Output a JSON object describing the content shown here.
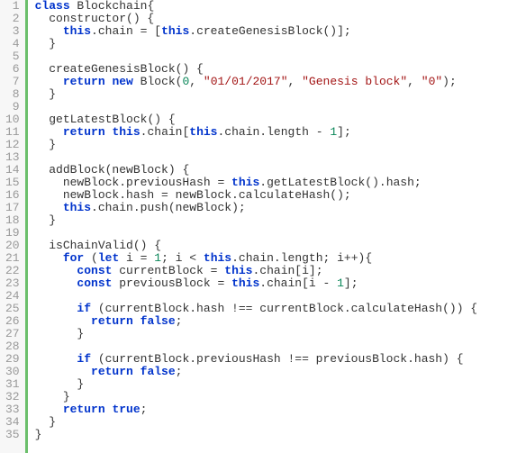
{
  "code": {
    "lines": [
      {
        "n": "1",
        "tokens": [
          {
            "t": "kw",
            "v": "class"
          },
          {
            "t": "name",
            "v": " Blockchain"
          },
          {
            "t": "punct",
            "v": "{"
          }
        ]
      },
      {
        "n": "2",
        "tokens": [
          {
            "t": "name",
            "v": "  constructor"
          },
          {
            "t": "punct",
            "v": "() {"
          }
        ]
      },
      {
        "n": "3",
        "tokens": [
          {
            "t": "name",
            "v": "    "
          },
          {
            "t": "this",
            "v": "this"
          },
          {
            "t": "punct",
            "v": ".chain = ["
          },
          {
            "t": "this",
            "v": "this"
          },
          {
            "t": "punct",
            "v": ".createGenesisBlock()];"
          }
        ]
      },
      {
        "n": "4",
        "tokens": [
          {
            "t": "punct",
            "v": "  }"
          }
        ]
      },
      {
        "n": "5",
        "tokens": [
          {
            "t": "name",
            "v": ""
          }
        ]
      },
      {
        "n": "6",
        "tokens": [
          {
            "t": "name",
            "v": "  createGenesisBlock"
          },
          {
            "t": "punct",
            "v": "() {"
          }
        ]
      },
      {
        "n": "7",
        "tokens": [
          {
            "t": "name",
            "v": "    "
          },
          {
            "t": "kw",
            "v": "return"
          },
          {
            "t": "name",
            "v": " "
          },
          {
            "t": "kw",
            "v": "new"
          },
          {
            "t": "name",
            "v": " Block("
          },
          {
            "t": "num",
            "v": "0"
          },
          {
            "t": "punct",
            "v": ", "
          },
          {
            "t": "str",
            "v": "\"01/01/2017\""
          },
          {
            "t": "punct",
            "v": ", "
          },
          {
            "t": "str",
            "v": "\"Genesis block\""
          },
          {
            "t": "punct",
            "v": ", "
          },
          {
            "t": "str",
            "v": "\"0\""
          },
          {
            "t": "punct",
            "v": ");"
          }
        ]
      },
      {
        "n": "8",
        "tokens": [
          {
            "t": "punct",
            "v": "  }"
          }
        ]
      },
      {
        "n": "9",
        "tokens": [
          {
            "t": "name",
            "v": ""
          }
        ]
      },
      {
        "n": "10",
        "tokens": [
          {
            "t": "name",
            "v": "  getLatestBlock"
          },
          {
            "t": "punct",
            "v": "() {"
          }
        ]
      },
      {
        "n": "11",
        "tokens": [
          {
            "t": "name",
            "v": "    "
          },
          {
            "t": "kw",
            "v": "return"
          },
          {
            "t": "name",
            "v": " "
          },
          {
            "t": "this",
            "v": "this"
          },
          {
            "t": "punct",
            "v": ".chain["
          },
          {
            "t": "this",
            "v": "this"
          },
          {
            "t": "punct",
            "v": ".chain.length - "
          },
          {
            "t": "num",
            "v": "1"
          },
          {
            "t": "punct",
            "v": "];"
          }
        ]
      },
      {
        "n": "12",
        "tokens": [
          {
            "t": "punct",
            "v": "  }"
          }
        ]
      },
      {
        "n": "13",
        "tokens": [
          {
            "t": "name",
            "v": ""
          }
        ]
      },
      {
        "n": "14",
        "tokens": [
          {
            "t": "name",
            "v": "  addBlock"
          },
          {
            "t": "punct",
            "v": "(newBlock) {"
          }
        ]
      },
      {
        "n": "15",
        "tokens": [
          {
            "t": "name",
            "v": "    newBlock.previousHash = "
          },
          {
            "t": "this",
            "v": "this"
          },
          {
            "t": "punct",
            "v": ".getLatestBlock().hash;"
          }
        ]
      },
      {
        "n": "16",
        "tokens": [
          {
            "t": "name",
            "v": "    newBlock.hash = newBlock.calculateHash();"
          }
        ]
      },
      {
        "n": "17",
        "tokens": [
          {
            "t": "name",
            "v": "    "
          },
          {
            "t": "this",
            "v": "this"
          },
          {
            "t": "punct",
            "v": ".chain.push(newBlock);"
          }
        ]
      },
      {
        "n": "18",
        "tokens": [
          {
            "t": "punct",
            "v": "  }"
          }
        ]
      },
      {
        "n": "19",
        "tokens": [
          {
            "t": "name",
            "v": ""
          }
        ]
      },
      {
        "n": "20",
        "tokens": [
          {
            "t": "name",
            "v": "  isChainValid"
          },
          {
            "t": "punct",
            "v": "() {"
          }
        ]
      },
      {
        "n": "21",
        "tokens": [
          {
            "t": "name",
            "v": "    "
          },
          {
            "t": "kw",
            "v": "for"
          },
          {
            "t": "punct",
            "v": " ("
          },
          {
            "t": "kw",
            "v": "let"
          },
          {
            "t": "name",
            "v": " i = "
          },
          {
            "t": "num",
            "v": "1"
          },
          {
            "t": "punct",
            "v": "; i < "
          },
          {
            "t": "this",
            "v": "this"
          },
          {
            "t": "punct",
            "v": ".chain.length; i++){"
          }
        ]
      },
      {
        "n": "22",
        "tokens": [
          {
            "t": "name",
            "v": "      "
          },
          {
            "t": "kw",
            "v": "const"
          },
          {
            "t": "name",
            "v": " currentBlock = "
          },
          {
            "t": "this",
            "v": "this"
          },
          {
            "t": "punct",
            "v": ".chain[i];"
          }
        ]
      },
      {
        "n": "23",
        "tokens": [
          {
            "t": "name",
            "v": "      "
          },
          {
            "t": "kw",
            "v": "const"
          },
          {
            "t": "name",
            "v": " previousBlock = "
          },
          {
            "t": "this",
            "v": "this"
          },
          {
            "t": "punct",
            "v": ".chain[i - "
          },
          {
            "t": "num",
            "v": "1"
          },
          {
            "t": "punct",
            "v": "];"
          }
        ]
      },
      {
        "n": "24",
        "tokens": [
          {
            "t": "name",
            "v": ""
          }
        ]
      },
      {
        "n": "25",
        "tokens": [
          {
            "t": "name",
            "v": "      "
          },
          {
            "t": "kw",
            "v": "if"
          },
          {
            "t": "punct",
            "v": " (currentBlock.hash !== currentBlock.calculateHash()) {"
          }
        ]
      },
      {
        "n": "26",
        "tokens": [
          {
            "t": "name",
            "v": "        "
          },
          {
            "t": "kw",
            "v": "return"
          },
          {
            "t": "name",
            "v": " "
          },
          {
            "t": "bool",
            "v": "false"
          },
          {
            "t": "punct",
            "v": ";"
          }
        ]
      },
      {
        "n": "27",
        "tokens": [
          {
            "t": "punct",
            "v": "      }"
          }
        ]
      },
      {
        "n": "28",
        "tokens": [
          {
            "t": "name",
            "v": ""
          }
        ]
      },
      {
        "n": "29",
        "tokens": [
          {
            "t": "name",
            "v": "      "
          },
          {
            "t": "kw",
            "v": "if"
          },
          {
            "t": "punct",
            "v": " (currentBlock.previousHash !== previousBlock.hash) {"
          }
        ]
      },
      {
        "n": "30",
        "tokens": [
          {
            "t": "name",
            "v": "        "
          },
          {
            "t": "kw",
            "v": "return"
          },
          {
            "t": "name",
            "v": " "
          },
          {
            "t": "bool",
            "v": "false"
          },
          {
            "t": "punct",
            "v": ";"
          }
        ]
      },
      {
        "n": "31",
        "tokens": [
          {
            "t": "punct",
            "v": "      }"
          }
        ]
      },
      {
        "n": "32",
        "tokens": [
          {
            "t": "punct",
            "v": "    }"
          }
        ]
      },
      {
        "n": "33",
        "tokens": [
          {
            "t": "name",
            "v": "    "
          },
          {
            "t": "kw",
            "v": "return"
          },
          {
            "t": "name",
            "v": " "
          },
          {
            "t": "bool",
            "v": "true"
          },
          {
            "t": "punct",
            "v": ";"
          }
        ]
      },
      {
        "n": "34",
        "tokens": [
          {
            "t": "punct",
            "v": "  }"
          }
        ]
      },
      {
        "n": "35",
        "tokens": [
          {
            "t": "punct",
            "v": "}"
          }
        ]
      }
    ]
  }
}
